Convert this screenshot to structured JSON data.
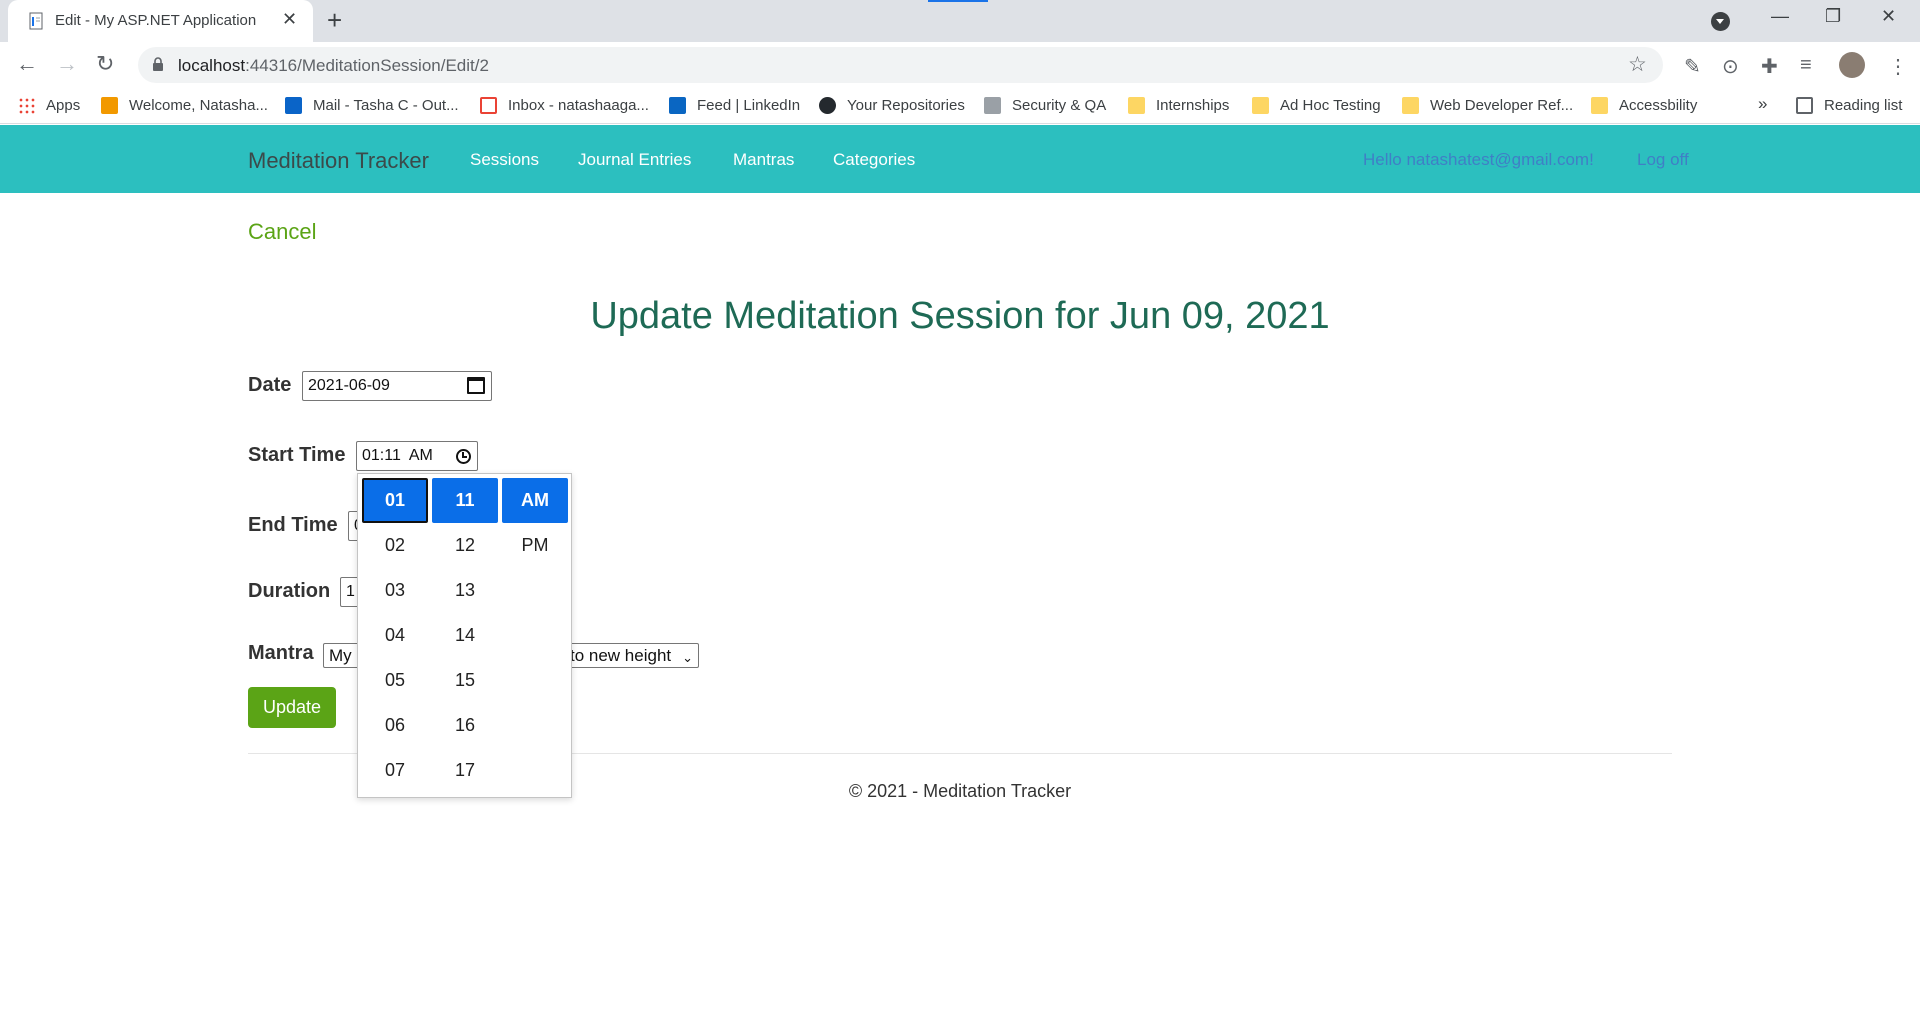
{
  "browser": {
    "tab_title": "Edit - My ASP.NET Application",
    "new_tab": "+",
    "url_host": "localhost",
    "url_rest": ":44316/MeditationSession/Edit/2",
    "bookmarks": [
      {
        "label": "Apps"
      },
      {
        "label": "Welcome, Natasha..."
      },
      {
        "label": "Mail - Tasha C - Out..."
      },
      {
        "label": "Inbox - natashaaga..."
      },
      {
        "label": "Feed | LinkedIn"
      },
      {
        "label": "Your Repositories"
      },
      {
        "label": "Security & QA"
      },
      {
        "label": "Internships"
      },
      {
        "label": "Ad Hoc Testing"
      },
      {
        "label": "Web Developer Ref..."
      },
      {
        "label": "Accessbility"
      }
    ],
    "more_bookmarks": "»",
    "reading_list": "Reading list"
  },
  "nav": {
    "brand": "Meditation Tracker",
    "links": [
      "Sessions",
      "Journal Entries",
      "Mantras",
      "Categories"
    ],
    "hello": "Hello natashatest@gmail.com!",
    "logoff": "Log off"
  },
  "page": {
    "cancel": "Cancel",
    "title": "Update Meditation Session for Jun 09, 2021"
  },
  "form": {
    "date_label": "Date",
    "date_value": "2021-06-09",
    "start_label": "Start Time",
    "start_value": "01:11  AM",
    "end_label": "End Time",
    "end_value": "0",
    "duration_label": "Duration",
    "duration_value": "1",
    "mantra_label": "Mantra",
    "mantra_value_start": "My",
    "mantra_value_end": "to new height",
    "update": "Update"
  },
  "time_picker": {
    "hours": [
      "01",
      "02",
      "03",
      "04",
      "05",
      "06",
      "07"
    ],
    "minutes": [
      "11",
      "12",
      "13",
      "14",
      "15",
      "16",
      "17"
    ],
    "periods": [
      "AM",
      "PM"
    ],
    "selected_hour": "01",
    "selected_minute": "11",
    "selected_period": "AM"
  },
  "footer": "© 2021 - Meditation Tracker",
  "colors": {
    "navbar": "#2cbfbf",
    "accent_green": "#5ba416",
    "title_green": "#1e6a55",
    "picker_selected": "#0a6ee8"
  }
}
